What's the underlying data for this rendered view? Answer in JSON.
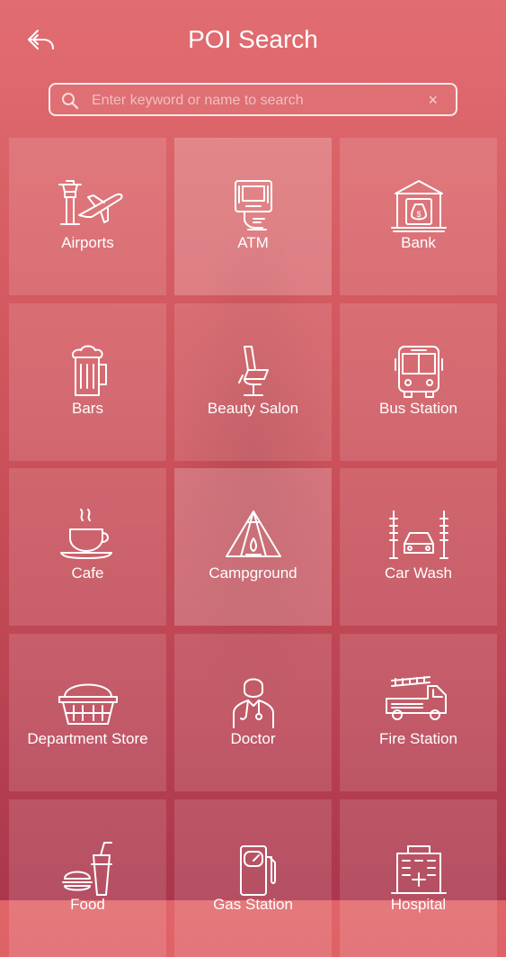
{
  "header": {
    "title": "POI Search"
  },
  "search": {
    "placeholder": "Enter keyword or name to search",
    "clear": "×"
  },
  "categories": [
    {
      "label": "Airports",
      "icon": "airport-icon"
    },
    {
      "label": "ATM",
      "icon": "atm-icon"
    },
    {
      "label": "Bank",
      "icon": "bank-icon"
    },
    {
      "label": "Bars",
      "icon": "beer-mug-icon"
    },
    {
      "label": "Beauty Salon",
      "icon": "salon-chair-icon"
    },
    {
      "label": "Bus Station",
      "icon": "bus-icon"
    },
    {
      "label": "Cafe",
      "icon": "coffee-cup-icon"
    },
    {
      "label": "Campground",
      "icon": "tent-icon"
    },
    {
      "label": "Car Wash",
      "icon": "car-wash-icon"
    },
    {
      "label": "Department Store",
      "icon": "basket-icon"
    },
    {
      "label": "Doctor",
      "icon": "doctor-icon"
    },
    {
      "label": "Fire Station",
      "icon": "fire-truck-icon"
    },
    {
      "label": "Food",
      "icon": "food-icon"
    },
    {
      "label": "Gas Station",
      "icon": "gas-pump-icon"
    },
    {
      "label": "Hospital",
      "icon": "hospital-icon"
    }
  ]
}
